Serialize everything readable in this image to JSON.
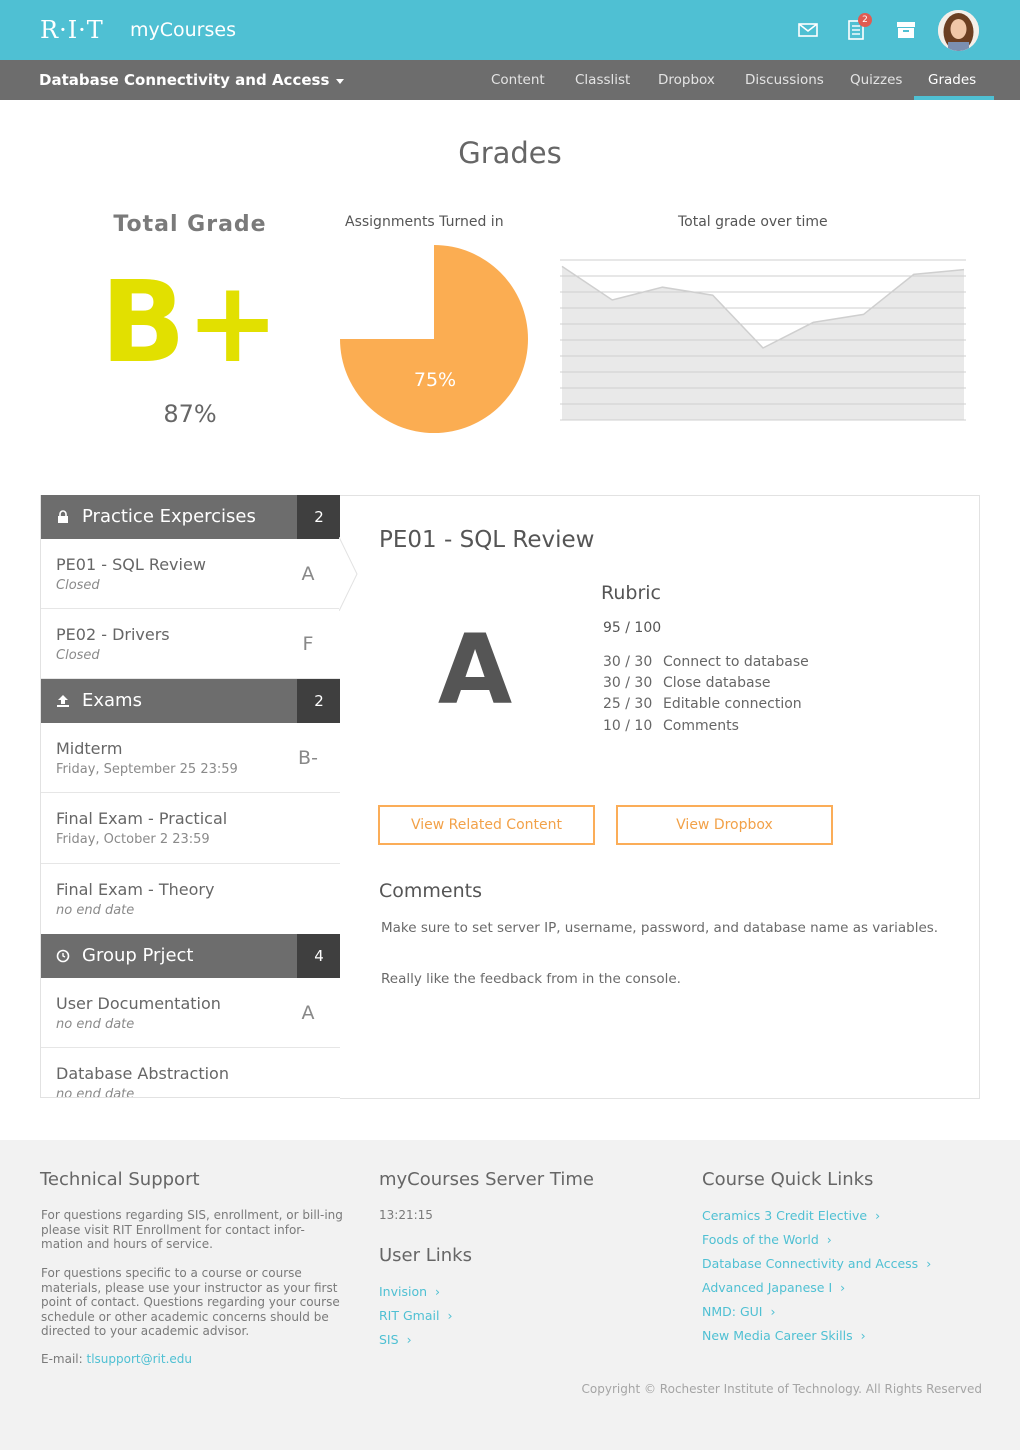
{
  "header": {
    "logo": "R·I·T",
    "app_name": "myCourses",
    "notification_count": "2"
  },
  "course_nav": {
    "course_title": "Database Connectivity and Access",
    "tabs": [
      "Content",
      "Classlist",
      "Dropbox",
      "Discussions",
      "Quizzes",
      "Grades"
    ],
    "active_tab": "Grades"
  },
  "page": {
    "title": "Grades"
  },
  "summary": {
    "total_grade_label": "Total Grade",
    "letter_grade": "B+",
    "percent": "87%",
    "accent_color": "#e2e000"
  },
  "chart_data": [
    {
      "type": "pie",
      "title": "Assignments Turned in",
      "values": [
        75,
        25
      ],
      "labels": [
        "75%"
      ],
      "colors": [
        "#fbad52",
        "#ffffff"
      ]
    },
    {
      "type": "area",
      "title": "Total grade over time",
      "x": [
        1,
        2,
        3,
        4,
        5,
        6,
        7,
        8,
        9,
        10
      ],
      "values": [
        96,
        75,
        83,
        78,
        45,
        61,
        66,
        91,
        94
      ],
      "ylim": [
        0,
        100
      ],
      "grid": true
    }
  ],
  "sections": [
    {
      "title": "Practice Expercises",
      "icon": "lock-icon",
      "count": "2",
      "items": [
        {
          "title": "PE01 - SQL Review",
          "subtitle": "Closed",
          "grade": "A"
        },
        {
          "title": "PE02 - Drivers",
          "subtitle": "Closed",
          "grade": "F"
        }
      ]
    },
    {
      "title": "Exams",
      "icon": "upload-icon",
      "count": "2",
      "items": [
        {
          "title": "Midterm",
          "subtitle": "Friday, September 25 23:59",
          "grade": "B-"
        },
        {
          "title": "Final Exam - Practical",
          "subtitle": "Friday, October 2 23:59",
          "grade": ""
        },
        {
          "title": "Final Exam - Theory",
          "subtitle": "no end date",
          "grade": ""
        }
      ]
    },
    {
      "title": "Group Prject",
      "icon": "clock-icon",
      "count": "4",
      "items": [
        {
          "title": "User Documentation",
          "subtitle": "no end date",
          "grade": "A"
        },
        {
          "title": "Database Abstraction",
          "subtitle": "no end date",
          "grade": ""
        }
      ]
    }
  ],
  "detail": {
    "title": "PE01 - SQL Review",
    "grade": "A",
    "rubric_title": "Rubric",
    "rubric_total": "95 / 100",
    "rubric_rows": [
      {
        "score": "30 / 30",
        "label": "Connect to database"
      },
      {
        "score": "30 / 30",
        "label": "Close database"
      },
      {
        "score": "25 / 30",
        "label": "Editable connection"
      },
      {
        "score": "10 / 10",
        "label": "Comments"
      }
    ],
    "buttons": {
      "related": "View Related Content",
      "dropbox": "View Dropbox"
    },
    "comments_title": "Comments",
    "comments": [
      "Make sure to set server IP, username, password, and database name as variables.",
      "Really like the feedback from in the console."
    ]
  },
  "footer": {
    "support_title": "Technical Support",
    "support_p1": "For questions regarding SIS, enrollment, or bill-ing please visit RIT Enrollment for contact infor-mation and hours of service.",
    "support_p2": "For questions specific to a course or course materials, please use your instructor as your first point of contact. Questions regarding your course schedule or other academic concerns should be directed to your academic advisor.",
    "email_label": "E-mail:",
    "email": "tlsupport@rit.edu",
    "server_time_title": "myCourses Server Time",
    "server_time": "13:21:15",
    "user_links_title": "User Links",
    "user_links": [
      "Invision",
      "RIT Gmail",
      "SIS"
    ],
    "quick_links_title": "Course Quick Links",
    "quick_links": [
      "Ceramics 3 Credit Elective",
      "Foods of the World",
      "Database Connectivity and Access",
      "Advanced Japanese I",
      "NMD: GUI",
      "New Media Career Skills"
    ],
    "copyright": "Copyright © Rochester Institute of Technology. All Rights Reserved"
  }
}
